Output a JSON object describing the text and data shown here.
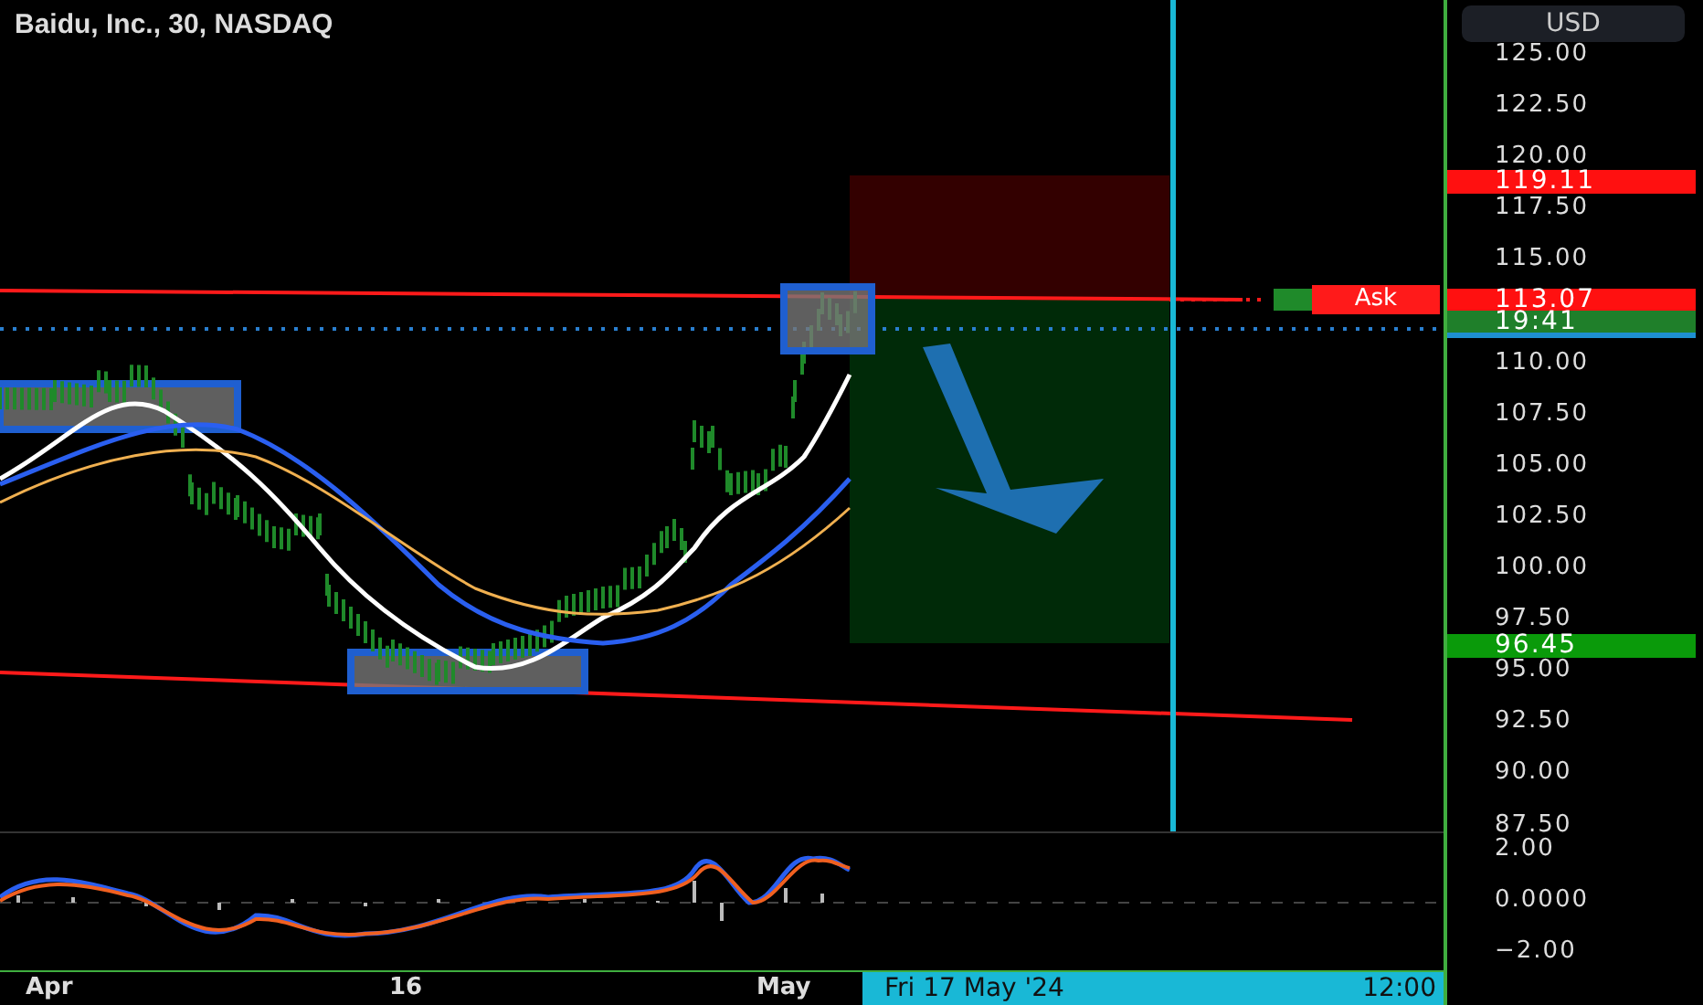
{
  "chart_title": "Baidu, Inc., 30, NASDAQ",
  "currency": "USD",
  "price_ticks": [
    "125.00",
    "122.50",
    "120.00",
    "117.50",
    "115.00",
    "110.00",
    "107.50",
    "105.00",
    "102.50",
    "100.00",
    "97.50",
    "95.00",
    "92.50",
    "90.00",
    "87.50"
  ],
  "price_tags": [
    {
      "kind": "stop",
      "text": "119.11"
    },
    {
      "kind": "ask",
      "text": "113.07",
      "label": "Ask"
    },
    {
      "kind": "countdown",
      "text": "19:41"
    },
    {
      "kind": "target",
      "text": "96.45"
    }
  ],
  "oscillator_ticks": [
    "2.00",
    "0.0000",
    "−2.00"
  ],
  "time_labels": [
    "Apr",
    "16",
    "May"
  ],
  "time_cursor": {
    "date": "Fri 17 May '24",
    "time": "12:00"
  }
}
